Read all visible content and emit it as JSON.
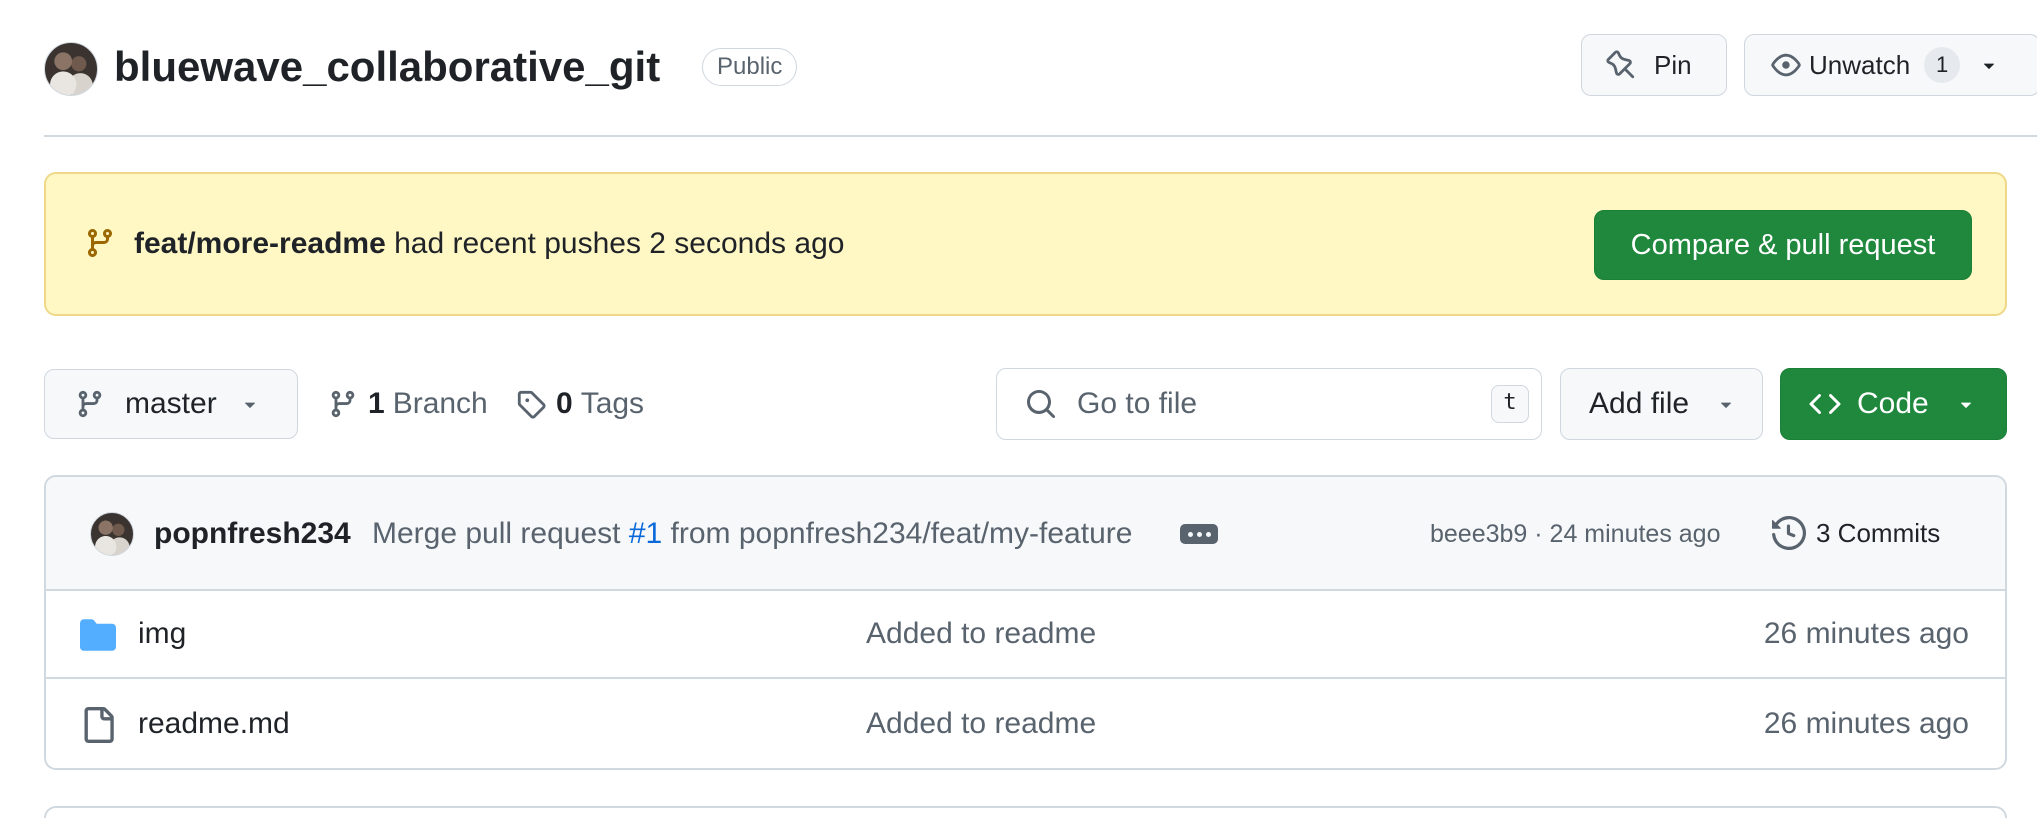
{
  "repo": {
    "name": "bluewave_collaborative_git",
    "visibility": "Public",
    "pin_label": "Pin",
    "watch_label": "Unwatch",
    "watch_count": "1"
  },
  "banner": {
    "branch": "feat/more-readme",
    "text": "had recent pushes 2 seconds ago",
    "compare_label": "Compare & pull request"
  },
  "toolbar": {
    "branch": "master",
    "branch_count": "1",
    "branch_word": "Branch",
    "tag_count": "0",
    "tag_word": "Tags",
    "goto_placeholder": "Go to file",
    "goto_shortcut": "t",
    "add_file_label": "Add file",
    "code_label": "Code"
  },
  "commit": {
    "author": "popnfresh234",
    "message_prefix": "Merge pull request",
    "pr_ref": "#1",
    "message_suffix": "from popnfresh234/feat/my-feature",
    "hash_time": "beee3b9 · 24 minutes ago",
    "commits_label": "3 Commits"
  },
  "files": [
    {
      "name": "img",
      "type": "folder",
      "message": "Added to readme",
      "time": "26 minutes ago"
    },
    {
      "name": "readme.md",
      "type": "file",
      "message": "Added to readme",
      "time": "26 minutes ago"
    }
  ],
  "icons": {
    "pin": "pin-icon",
    "eye": "eye-icon",
    "branch": "git-branch-icon",
    "tag": "tag-icon",
    "search": "search-icon",
    "code": "code-icon",
    "history": "history-icon",
    "folder": "folder-icon",
    "file": "file-icon"
  },
  "colors": {
    "accent_green": "#1f883d",
    "banner_bg": "#fff8c5",
    "link_blue": "#0969da",
    "folder_blue": "#54aeff"
  }
}
